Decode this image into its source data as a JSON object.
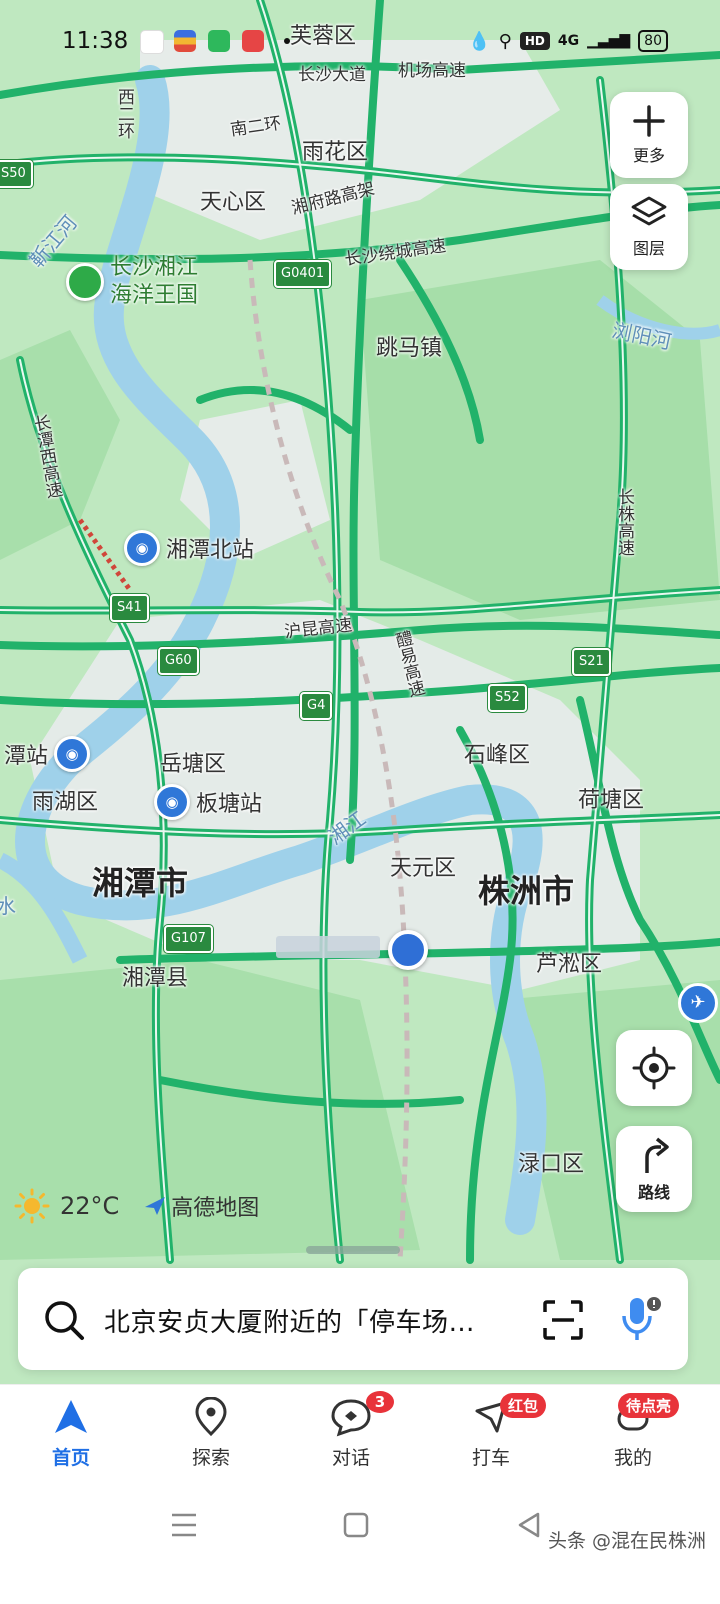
{
  "status_bar": {
    "time": "11:38",
    "network": "4G",
    "hd": "HD",
    "battery": "80"
  },
  "map": {
    "districts": {
      "furong": "芙蓉区",
      "yuhua": "雨花区",
      "tianxin": "天心区",
      "shifeng": "石峰区",
      "yuetang": "岳塘区",
      "yuhu": "雨湖区",
      "hetang": "荷塘区",
      "tianyuan": "天元区",
      "lusong": "芦淞区",
      "lukou": "渌口区",
      "xiangtan_county": "湘潭县"
    },
    "cities": {
      "xiangtan": "湘潭市",
      "zhuzhou": "株洲市"
    },
    "towns": {
      "tiaoma": "跳马镇"
    },
    "roads": {
      "changsha_avenue": "长沙大道",
      "airport_expressway": "机场高速",
      "south_2nd_ring": "南二环",
      "west_2nd_ring": "西二环",
      "xiangfu_viaduct": "湘府路高架",
      "ring_expressway": "长沙绕城高速",
      "changtan_west": "长潭西高速",
      "hukun": "沪昆高速",
      "changzhu": "长株高速",
      "liling": "醴易高速"
    },
    "rivers": {
      "xinjiang": "靳江河",
      "liuyang": "浏阳河",
      "xiangjiang": "湘江",
      "partial": "水"
    },
    "shields": [
      "S50",
      "G0401",
      "S41",
      "G60",
      "G4",
      "S21",
      "S52",
      "G107"
    ],
    "pois": {
      "ocean_park": [
        "长沙湘江",
        "海洋王国"
      ],
      "xiangtan_north_station": "湘潭北站",
      "banting_station": "板塘站",
      "partial_station": "潭站"
    }
  },
  "controls": {
    "more": "更多",
    "layers": "图层",
    "route": "路线"
  },
  "weather": {
    "temp": "22°C",
    "brand": "高德地图"
  },
  "search": {
    "placeholder": "北京安贞大厦附近的「停车场…"
  },
  "bottom_nav": {
    "items": [
      {
        "label": "首页",
        "active": true
      },
      {
        "label": "探索"
      },
      {
        "label": "对话",
        "badge": "3"
      },
      {
        "label": "打车",
        "badge": "红包"
      },
      {
        "label": "我的",
        "badge": "待点亮"
      }
    ]
  },
  "watermark": "头条 @混在民株洲"
}
